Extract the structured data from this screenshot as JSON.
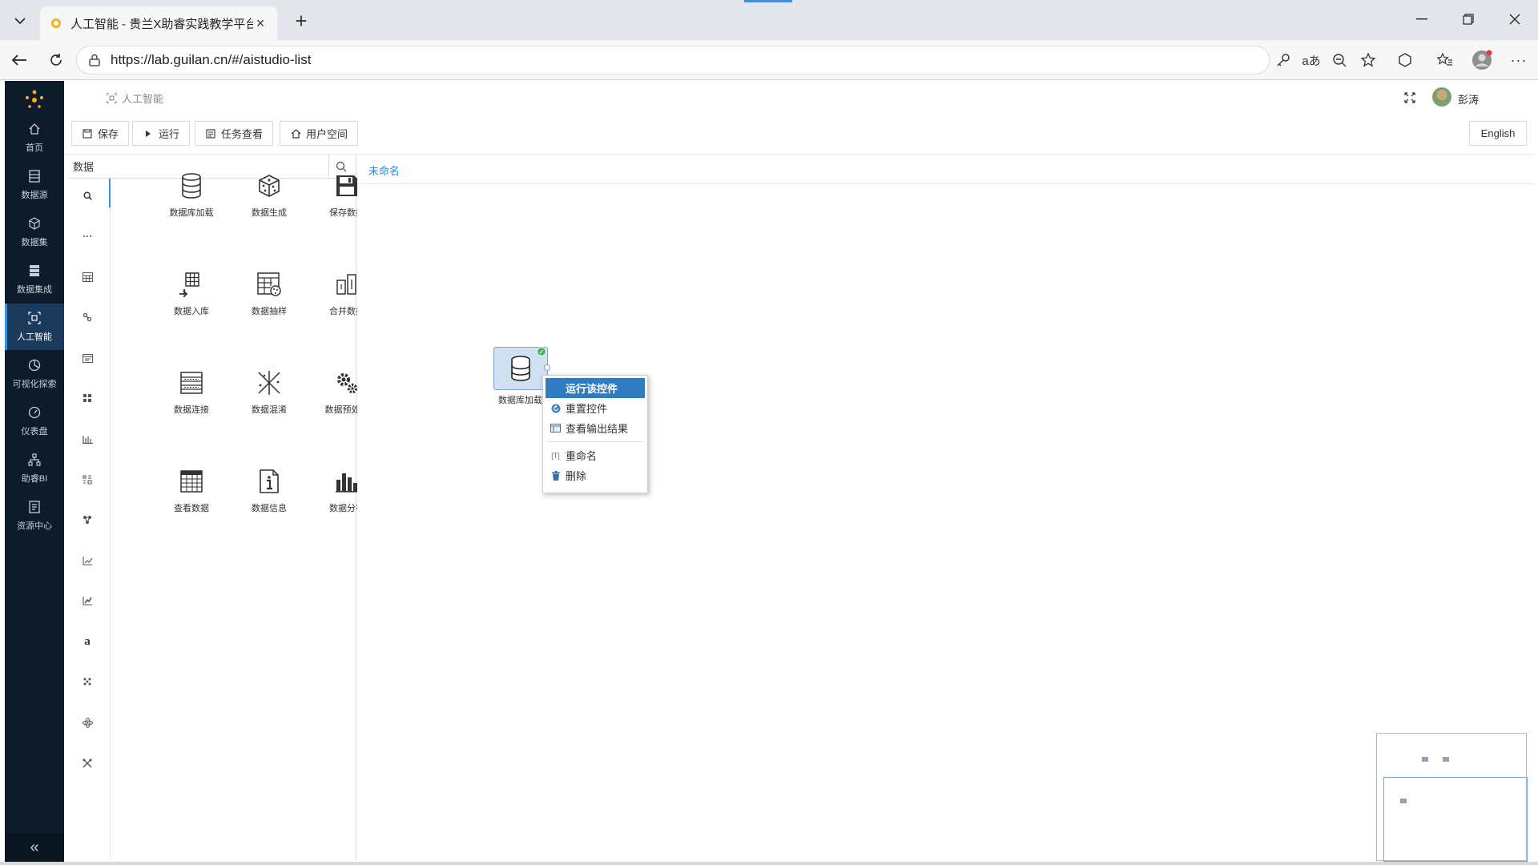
{
  "browser": {
    "tab_title": "人工智能 - 贵兰X助睿实践教学平台",
    "url": "https://lab.guilan.cn/#/aistudio-list"
  },
  "sidebar": {
    "items": [
      {
        "label": "首页",
        "icon": "home-icon"
      },
      {
        "label": "数据源",
        "icon": "datasource-icon"
      },
      {
        "label": "数据集",
        "icon": "dataset-icon"
      },
      {
        "label": "数据集成",
        "icon": "integration-icon"
      },
      {
        "label": "人工智能",
        "icon": "ai-icon"
      },
      {
        "label": "可视化探索",
        "icon": "chart-pie-icon"
      },
      {
        "label": "仪表盘",
        "icon": "dashboard-icon"
      },
      {
        "label": "助睿BI",
        "icon": "bi-icon"
      },
      {
        "label": "资源中心",
        "icon": "resource-icon"
      }
    ],
    "active": "人工智能",
    "collapse_label": "«"
  },
  "header": {
    "breadcrumb": "人工智能",
    "username": "彭涛"
  },
  "toolbar": {
    "save": "保存",
    "run": "运行",
    "tasks": "任务查看",
    "userspace": "用户空间",
    "language": "English"
  },
  "panel": {
    "search_value": "数据",
    "components": [
      {
        "label": "数据库加载",
        "icon": "database-icon"
      },
      {
        "label": "数据生成",
        "icon": "dice-icon"
      },
      {
        "label": "保存数据",
        "icon": "floppy-disk-icon"
      },
      {
        "label": "数据入库",
        "icon": "table-import-icon"
      },
      {
        "label": "数据抽样",
        "icon": "table-sample-icon"
      },
      {
        "label": "合并数据",
        "icon": "merge-icon"
      },
      {
        "label": "数据连接",
        "icon": "table-join-icon"
      },
      {
        "label": "数据混淆",
        "icon": "scatter-cross-icon"
      },
      {
        "label": "数据预处理",
        "icon": "gears-icon"
      },
      {
        "label": "查看数据",
        "icon": "table-view-icon"
      },
      {
        "label": "数据信息",
        "icon": "info-document-icon"
      },
      {
        "label": "数据分布",
        "icon": "bar-chart-icon"
      }
    ]
  },
  "canvas": {
    "tab": "未命名",
    "node_label": "数据库加载"
  },
  "context_menu": {
    "items": [
      {
        "label": "运行该控件",
        "icon": "run-icon",
        "highlighted": true
      },
      {
        "label": "重置控件",
        "icon": "reset-icon",
        "highlighted": false
      },
      {
        "label": "查看输出结果",
        "icon": "output-icon",
        "highlighted": false
      },
      {
        "label": "重命名",
        "icon": "rename-icon",
        "highlighted": false
      },
      {
        "label": "删除",
        "icon": "trash-icon",
        "highlighted": false
      }
    ]
  },
  "colors": {
    "sidebar_bg": "#0d1b2a",
    "accent": "#2f88d6",
    "menu_highlight": "#2f7cc1",
    "node_fill": "#cfe0f1",
    "status_ok": "#48b96a"
  }
}
